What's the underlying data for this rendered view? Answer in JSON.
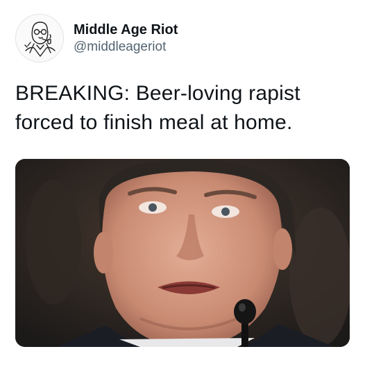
{
  "account": {
    "display_name": "Middle Age Riot",
    "handle": "@middleageriot",
    "avatar_icon": "cartoon-man-pipe-avatar-icon"
  },
  "tweet": {
    "text": "BREAKING: Beer-loving rapist forced to finish meal at home."
  },
  "media": {
    "icon": "photo-portrait-icon",
    "background_color": "#2a2a2a"
  },
  "colors": {
    "text_primary": "#0f1419",
    "text_secondary": "#536471",
    "background": "#ffffff"
  }
}
